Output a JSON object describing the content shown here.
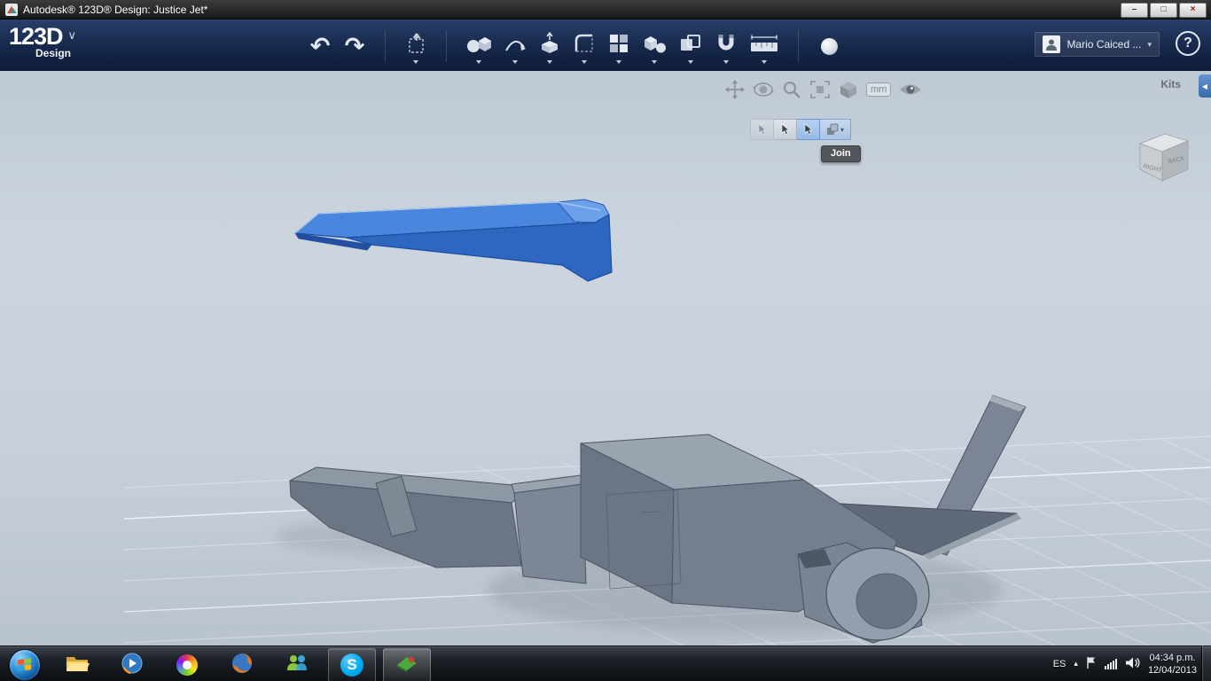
{
  "window": {
    "title": "Autodesk® 123D® Design: Justice Jet*",
    "controls": {
      "min": "–",
      "max": "□",
      "close": "×"
    }
  },
  "app_bar": {
    "logo": "123D",
    "logo_chevron": "∨",
    "logo_sub": "Design",
    "glyphs": {
      "undo": "↶",
      "redo": "↷"
    },
    "tools": [
      "undo",
      "redo",
      "transform-move",
      "primitives",
      "sketch",
      "construct",
      "modify",
      "pattern",
      "group",
      "combine",
      "snap",
      "measure",
      "material-sphere"
    ],
    "user": {
      "name": "Mario Caiced ...",
      "dropdown": "▾"
    },
    "help": "?"
  },
  "viewport": {
    "nav_tools": [
      "pan",
      "orbit",
      "zoom",
      "zoom-fit",
      "view",
      "units",
      "visibility"
    ],
    "units_label": "mm",
    "selection": {
      "tooltip": "Join",
      "dropdown": "▾"
    },
    "kits_label": "Kits",
    "collapse_glyph": "◀",
    "viewcube": {
      "left_face": "RIGHT",
      "right_face": "BACK"
    }
  },
  "scene": {
    "parts": [
      "wing-blue-selected",
      "jet-tail-fin",
      "jet-stabilizer",
      "jet-fuselage",
      "jet-engine"
    ]
  },
  "taskbar": {
    "apps": [
      "windows-explorer",
      "windows-media-player",
      "color-app",
      "firefox",
      "windows-live-messenger",
      "skype",
      "123d-design"
    ],
    "skype_glyph": "S",
    "tray": {
      "language": "ES",
      "hidden_icons_glyph": "▴",
      "time": "04:34 p.m.",
      "date": "12/04/2013"
    }
  }
}
